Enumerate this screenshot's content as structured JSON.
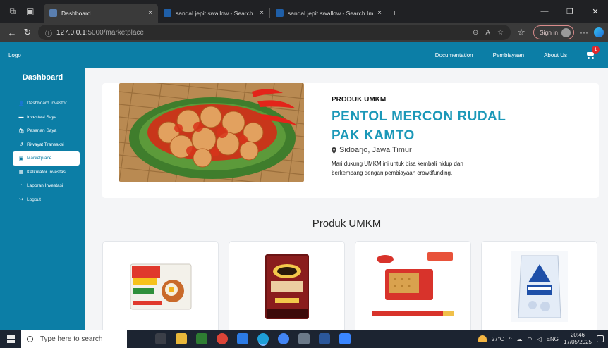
{
  "browser": {
    "tabs": [
      {
        "title": "Dashboard",
        "active": true,
        "favicon_color": "#5a7fb0"
      },
      {
        "title": "sandal jepit swallow - Search",
        "active": false,
        "favicon_color": "#1f5fa8"
      },
      {
        "title": "sandal jepit swallow - Search Ima",
        "active": false,
        "favicon_color": "#1f5fa8"
      }
    ],
    "close_glyph": "×",
    "new_tab_glyph": "+",
    "url_host": "127.0.0.1",
    "url_rest": ":5000/marketplace",
    "sign_in_label": "Sign in"
  },
  "appnav": {
    "logo": "Logo",
    "links": [
      "Documentation",
      "Pembiayaan",
      "About Us"
    ],
    "cart_count": "1"
  },
  "sidebar": {
    "title": "Dashboard",
    "items": [
      {
        "label": "Dashboard Investor",
        "icon": "user-icon",
        "glyph": "👤",
        "active": false
      },
      {
        "label": "Investasi Saya",
        "icon": "wallet-icon",
        "glyph": "▬",
        "active": false
      },
      {
        "label": "Pesanan Saya",
        "icon": "bag-icon",
        "glyph": "🛍",
        "active": false
      },
      {
        "label": "Riwayat Transaksi",
        "icon": "history-icon",
        "glyph": "↺",
        "active": false
      },
      {
        "label": "Marketplace",
        "icon": "store-icon",
        "glyph": "▣",
        "active": true
      },
      {
        "label": "Kalkulator Investasi",
        "icon": "calculator-icon",
        "glyph": "▦",
        "active": false
      },
      {
        "label": "Laporan Investasi",
        "icon": "chart-icon",
        "glyph": "◔",
        "active": false
      },
      {
        "label": "Logout",
        "icon": "logout-icon",
        "glyph": "↪",
        "active": false
      }
    ]
  },
  "hero": {
    "eyebrow": "PRODUK UMKM",
    "name_line1": "PENTOL MERCON RUDAL",
    "name_line2": "PAK KAMTO",
    "location": "Sidoarjo, Jawa Timur",
    "description": "Mari dukung  UMKM ini untuk bisa kembali hidup dan berkembang dengan pembiayaan crowdfunding."
  },
  "products_section": {
    "title": "Produk UMKM"
  },
  "taskbar": {
    "search_placeholder": "Type here to search",
    "temperature": "27°C",
    "language": "ENG",
    "time": "20:46",
    "date": "17/05/2025"
  },
  "colors": {
    "brand": "#0c7ea6",
    "accent_title": "#1b98b8",
    "badge": "#e0282d"
  }
}
